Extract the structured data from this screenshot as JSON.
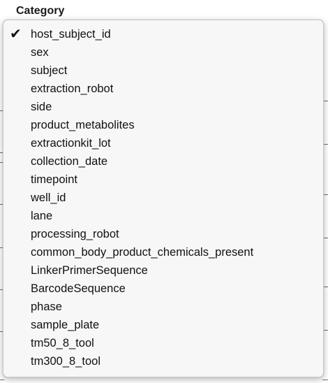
{
  "header": {
    "label": "Category"
  },
  "menu": {
    "selected_index": 0,
    "items": [
      {
        "label": "host_subject_id",
        "checked": true
      },
      {
        "label": "sex",
        "checked": false
      },
      {
        "label": "subject",
        "checked": false
      },
      {
        "label": "extraction_robot",
        "checked": false
      },
      {
        "label": "side",
        "checked": false
      },
      {
        "label": "product_metabolites",
        "checked": false
      },
      {
        "label": "extractionkit_lot",
        "checked": false
      },
      {
        "label": "collection_date",
        "checked": false
      },
      {
        "label": "timepoint",
        "checked": false
      },
      {
        "label": "well_id",
        "checked": false
      },
      {
        "label": "lane",
        "checked": false
      },
      {
        "label": "processing_robot",
        "checked": false
      },
      {
        "label": "common_body_product_chemicals_present",
        "checked": false
      },
      {
        "label": "LinkerPrimerSequence",
        "checked": false
      },
      {
        "label": "BarcodeSequence",
        "checked": false
      },
      {
        "label": "phase",
        "checked": false
      },
      {
        "label": "sample_plate",
        "checked": false
      },
      {
        "label": "tm50_8_tool",
        "checked": false
      },
      {
        "label": "tm300_8_tool",
        "checked": false
      }
    ]
  },
  "icons": {
    "checkmark": "check-icon"
  }
}
